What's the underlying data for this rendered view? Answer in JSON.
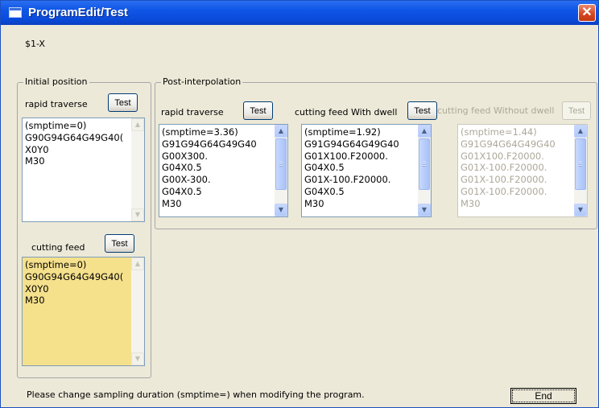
{
  "window": {
    "title": "ProgramEdit/Test",
    "close_glyph": "✕"
  },
  "axis_label": "$1-X",
  "initial": {
    "legend": "Initial position",
    "rapid": {
      "label": "rapid traverse",
      "test_label": "Test",
      "lines": [
        "(smptime=0)",
        "G90G94G64G49G40(",
        "X0Y0",
        "M30"
      ]
    },
    "cutting": {
      "label": "cutting feed",
      "test_label": "Test",
      "lines": [
        "(smptime=0)",
        "G90G94G64G49G40(",
        "X0Y0",
        "M30"
      ]
    }
  },
  "post": {
    "legend": "Post-interpolation",
    "rapid": {
      "label": "rapid traverse",
      "test_label": "Test",
      "lines": [
        "(smptime=3.36)",
        "G91G94G64G49G40",
        "G00X300.",
        "G04X0.5",
        "G00X-300.",
        "G04X0.5",
        "M30"
      ]
    },
    "with_dwell": {
      "label": "cutting feed With dwell",
      "test_label": "Test",
      "lines": [
        "(smptime=1.92)",
        "G91G94G64G49G40",
        "G01X100.F20000.",
        "G04X0.5",
        "G01X-100.F20000.",
        "G04X0.5",
        "M30"
      ]
    },
    "without_dwell": {
      "label": "cutting feed Without dwell",
      "test_label": "Test",
      "lines": [
        "(smptime=1.44)",
        "G91G94G64G49G40",
        "G01X100.F20000.",
        "G01X-100.F20000.",
        "G01X-100.F20000.",
        "G01X-100.F20000.",
        "M30"
      ]
    }
  },
  "status_text": "Please change sampling duration (smptime=) when modifying the program.",
  "end_label": "End",
  "colors": {
    "title_bar": "#0a4ad8",
    "face": "#ece9d8",
    "yellow_box": "#f5e08c",
    "close": "#d4441f"
  }
}
